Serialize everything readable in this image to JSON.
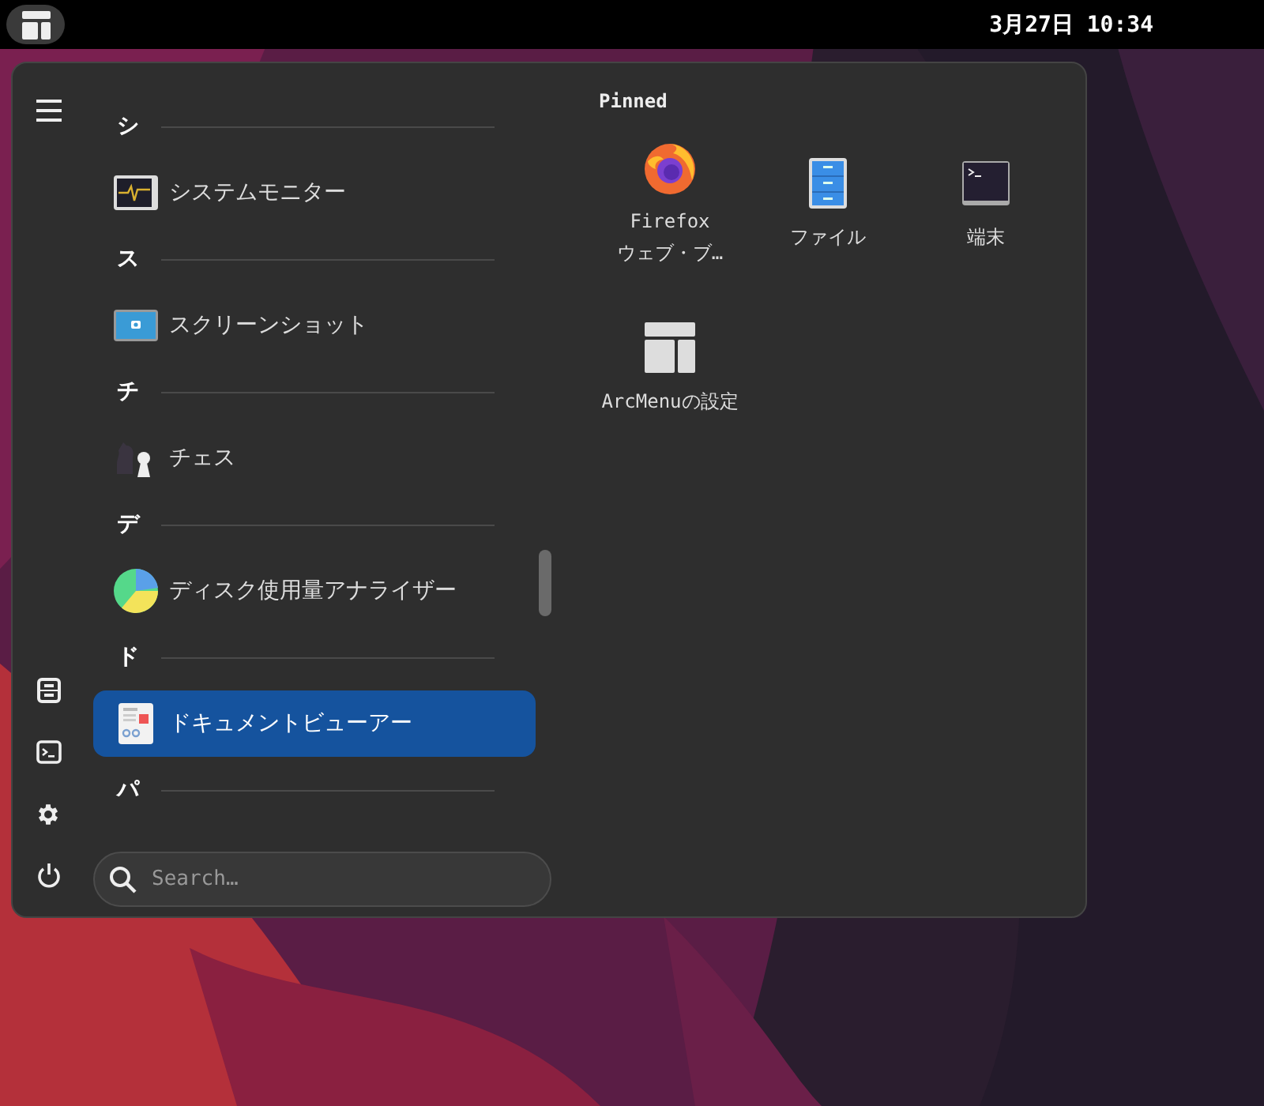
{
  "top_bar": {
    "clock": "3月27日 10:34"
  },
  "sidebar": {
    "items": [
      {
        "kind": "menu"
      },
      {
        "kind": "files"
      },
      {
        "kind": "terminal"
      },
      {
        "kind": "settings"
      },
      {
        "kind": "power"
      }
    ]
  },
  "app_list": [
    {
      "kind": "header",
      "label": "シ"
    },
    {
      "kind": "app",
      "label": "システムモニター",
      "selected": false
    },
    {
      "kind": "header",
      "label": "ス"
    },
    {
      "kind": "app",
      "label": "スクリーンショット",
      "selected": false
    },
    {
      "kind": "header",
      "label": "チ"
    },
    {
      "kind": "app",
      "label": "チェス",
      "selected": false
    },
    {
      "kind": "header",
      "label": "デ"
    },
    {
      "kind": "app",
      "label": "ディスク使用量アナライザー",
      "selected": false
    },
    {
      "kind": "header",
      "label": "ド"
    },
    {
      "kind": "app",
      "label": "ドキュメントビューアー",
      "selected": true
    },
    {
      "kind": "header",
      "label": "パ"
    }
  ],
  "search": {
    "placeholder": "Search…"
  },
  "pinned": {
    "title": "Pinned",
    "items": [
      {
        "label": "Firefox ウェブ・ブ…"
      },
      {
        "label": "ファイル"
      },
      {
        "label": "端末"
      },
      {
        "label": "ArcMenuの設定"
      }
    ]
  }
}
